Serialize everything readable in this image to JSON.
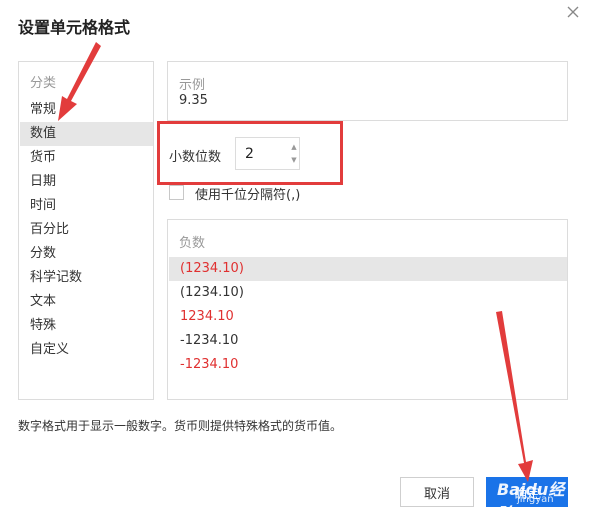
{
  "dialog": {
    "title": "设置单元格格式"
  },
  "category": {
    "header": "分类",
    "items": [
      {
        "label": "常规"
      },
      {
        "label": "数值"
      },
      {
        "label": "货币"
      },
      {
        "label": "日期"
      },
      {
        "label": "时间"
      },
      {
        "label": "百分比"
      },
      {
        "label": "分数"
      },
      {
        "label": "科学记数"
      },
      {
        "label": "文本"
      },
      {
        "label": "特殊"
      },
      {
        "label": "自定义"
      }
    ],
    "selected": "数值"
  },
  "sample": {
    "header": "示例",
    "value": "9.35"
  },
  "decimal": {
    "label": "小数位数",
    "value": "2"
  },
  "thousand": {
    "label": "使用千位分隔符(,)",
    "checked": false
  },
  "negative": {
    "header": "负数",
    "items": [
      {
        "label": "(1234.10)",
        "color": "#e03030"
      },
      {
        "label": "(1234.10)",
        "color": "#333333"
      },
      {
        "label": "1234.10",
        "color": "#e03030"
      },
      {
        "label": "-1234.10",
        "color": "#333333"
      },
      {
        "label": "-1234.10",
        "color": "#e03030"
      }
    ]
  },
  "description": "数字格式用于显示一般数字。货币则提供特殊格式的货币值。",
  "buttons": {
    "cancel": "取消",
    "ok": "确定"
  },
  "watermark": {
    "text": "Baidu经验",
    "sub": "jingyan"
  },
  "colors": {
    "accent": "#1a73e8",
    "annotation": "#e23c3c",
    "negative_red": "#e03030",
    "selection_bg": "#e6e6e6"
  }
}
